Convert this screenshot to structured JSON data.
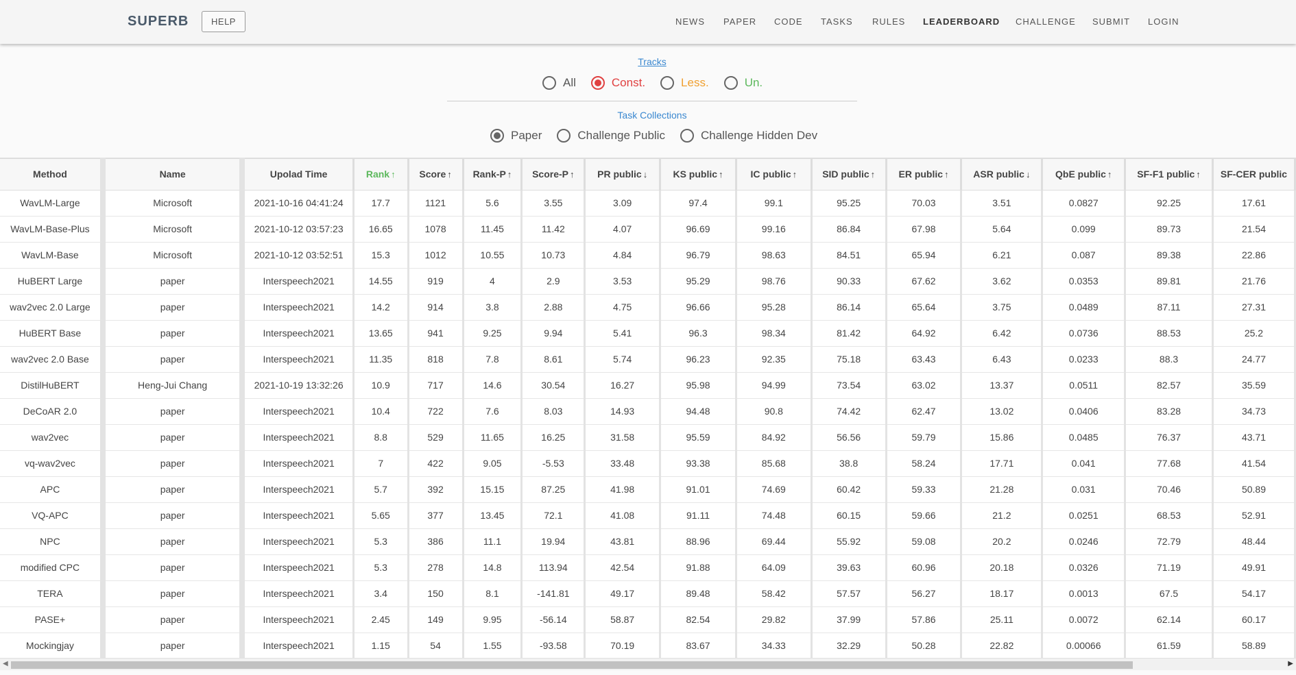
{
  "header": {
    "brand": "SUPERB",
    "help": "HELP",
    "nav": [
      "NEWS",
      "PAPER",
      "CODE",
      "TASKS",
      "RULES",
      "LEADERBOARD",
      "CHALLENGE",
      "SUBMIT",
      "LOGIN"
    ],
    "active_nav": "LEADERBOARD"
  },
  "tracks": {
    "title": "Tracks",
    "options": [
      {
        "label": "All",
        "color": "#555555",
        "checked": false
      },
      {
        "label": "Const.",
        "color": "#e04040",
        "checked": true
      },
      {
        "label": "Less.",
        "color": "#f0a030",
        "checked": false
      },
      {
        "label": "Un.",
        "color": "#5cb85c",
        "checked": false
      }
    ]
  },
  "task_collections": {
    "title": "Task Collections",
    "options": [
      {
        "label": "Paper",
        "checked": true
      },
      {
        "label": "Challenge Public",
        "checked": false
      },
      {
        "label": "Challenge Hidden Dev",
        "checked": false
      }
    ]
  },
  "table": {
    "columns": [
      {
        "label": "Method",
        "arrow": ""
      },
      {
        "label": "Name",
        "arrow": ""
      },
      {
        "label": "Upolad Time",
        "arrow": ""
      },
      {
        "label": "Rank",
        "arrow": "↑"
      },
      {
        "label": "Score",
        "arrow": "↑"
      },
      {
        "label": "Rank-P",
        "arrow": "↑"
      },
      {
        "label": "Score-P",
        "arrow": "↑"
      },
      {
        "label": "PR public",
        "arrow": "↓"
      },
      {
        "label": "KS public",
        "arrow": "↑"
      },
      {
        "label": "IC public",
        "arrow": "↑"
      },
      {
        "label": "SID public",
        "arrow": "↑"
      },
      {
        "label": "ER public",
        "arrow": "↑"
      },
      {
        "label": "ASR public",
        "arrow": "↓"
      },
      {
        "label": "QbE public",
        "arrow": "↑"
      },
      {
        "label": "SF-F1 public",
        "arrow": "↑"
      },
      {
        "label": "SF-CER public",
        "arrow": ""
      }
    ],
    "rows": [
      [
        "WavLM-Large",
        "Microsoft",
        "2021-10-16 04:41:24",
        "17.7",
        "1121",
        "5.6",
        "3.55",
        "3.09",
        "97.4",
        "99.1",
        "95.25",
        "70.03",
        "3.51",
        "0.0827",
        "92.25",
        "17.61"
      ],
      [
        "WavLM-Base-Plus",
        "Microsoft",
        "2021-10-12 03:57:23",
        "16.65",
        "1078",
        "11.45",
        "11.42",
        "4.07",
        "96.69",
        "99.16",
        "86.84",
        "67.98",
        "5.64",
        "0.099",
        "89.73",
        "21.54"
      ],
      [
        "WavLM-Base",
        "Microsoft",
        "2021-10-12 03:52:51",
        "15.3",
        "1012",
        "10.55",
        "10.73",
        "4.84",
        "96.79",
        "98.63",
        "84.51",
        "65.94",
        "6.21",
        "0.087",
        "89.38",
        "22.86"
      ],
      [
        "HuBERT Large",
        "paper",
        "Interspeech2021",
        "14.55",
        "919",
        "4",
        "2.9",
        "3.53",
        "95.29",
        "98.76",
        "90.33",
        "67.62",
        "3.62",
        "0.0353",
        "89.81",
        "21.76"
      ],
      [
        "wav2vec 2.0 Large",
        "paper",
        "Interspeech2021",
        "14.2",
        "914",
        "3.8",
        "2.88",
        "4.75",
        "96.66",
        "95.28",
        "86.14",
        "65.64",
        "3.75",
        "0.0489",
        "87.11",
        "27.31"
      ],
      [
        "HuBERT Base",
        "paper",
        "Interspeech2021",
        "13.65",
        "941",
        "9.25",
        "9.94",
        "5.41",
        "96.3",
        "98.34",
        "81.42",
        "64.92",
        "6.42",
        "0.0736",
        "88.53",
        "25.2"
      ],
      [
        "wav2vec 2.0 Base",
        "paper",
        "Interspeech2021",
        "11.35",
        "818",
        "7.8",
        "8.61",
        "5.74",
        "96.23",
        "92.35",
        "75.18",
        "63.43",
        "6.43",
        "0.0233",
        "88.3",
        "24.77"
      ],
      [
        "DistilHuBERT",
        "Heng-Jui Chang",
        "2021-10-19 13:32:26",
        "10.9",
        "717",
        "14.6",
        "30.54",
        "16.27",
        "95.98",
        "94.99",
        "73.54",
        "63.02",
        "13.37",
        "0.0511",
        "82.57",
        "35.59"
      ],
      [
        "DeCoAR 2.0",
        "paper",
        "Interspeech2021",
        "10.4",
        "722",
        "7.6",
        "8.03",
        "14.93",
        "94.48",
        "90.8",
        "74.42",
        "62.47",
        "13.02",
        "0.0406",
        "83.28",
        "34.73"
      ],
      [
        "wav2vec",
        "paper",
        "Interspeech2021",
        "8.8",
        "529",
        "11.65",
        "16.25",
        "31.58",
        "95.59",
        "84.92",
        "56.56",
        "59.79",
        "15.86",
        "0.0485",
        "76.37",
        "43.71"
      ],
      [
        "vq-wav2vec",
        "paper",
        "Interspeech2021",
        "7",
        "422",
        "9.05",
        "-5.53",
        "33.48",
        "93.38",
        "85.68",
        "38.8",
        "58.24",
        "17.71",
        "0.041",
        "77.68",
        "41.54"
      ],
      [
        "APC",
        "paper",
        "Interspeech2021",
        "5.7",
        "392",
        "15.15",
        "87.25",
        "41.98",
        "91.01",
        "74.69",
        "60.42",
        "59.33",
        "21.28",
        "0.031",
        "70.46",
        "50.89"
      ],
      [
        "VQ-APC",
        "paper",
        "Interspeech2021",
        "5.65",
        "377",
        "13.45",
        "72.1",
        "41.08",
        "91.11",
        "74.48",
        "60.15",
        "59.66",
        "21.2",
        "0.0251",
        "68.53",
        "52.91"
      ],
      [
        "NPC",
        "paper",
        "Interspeech2021",
        "5.3",
        "386",
        "11.1",
        "19.94",
        "43.81",
        "88.96",
        "69.44",
        "55.92",
        "59.08",
        "20.2",
        "0.0246",
        "72.79",
        "48.44"
      ],
      [
        "modified CPC",
        "paper",
        "Interspeech2021",
        "5.3",
        "278",
        "14.8",
        "113.94",
        "42.54",
        "91.88",
        "64.09",
        "39.63",
        "60.96",
        "20.18",
        "0.0326",
        "71.19",
        "49.91"
      ],
      [
        "TERA",
        "paper",
        "Interspeech2021",
        "3.4",
        "150",
        "8.1",
        "-141.81",
        "49.17",
        "89.48",
        "58.42",
        "57.57",
        "56.27",
        "18.17",
        "0.0013",
        "67.5",
        "54.17"
      ],
      [
        "PASE+",
        "paper",
        "Interspeech2021",
        "2.45",
        "149",
        "9.95",
        "-56.14",
        "58.87",
        "82.54",
        "29.82",
        "37.99",
        "57.86",
        "25.11",
        "0.0072",
        "62.14",
        "60.17"
      ],
      [
        "Mockingjay",
        "paper",
        "Interspeech2021",
        "1.15",
        "54",
        "1.55",
        "-93.58",
        "70.19",
        "83.67",
        "34.33",
        "32.29",
        "50.28",
        "22.82",
        "0.00066",
        "61.59",
        "58.89"
      ]
    ]
  },
  "scrollbar": {
    "left_arrow_icon": "scroll-left-arrow",
    "right_arrow_icon": "scroll-right-arrow"
  }
}
